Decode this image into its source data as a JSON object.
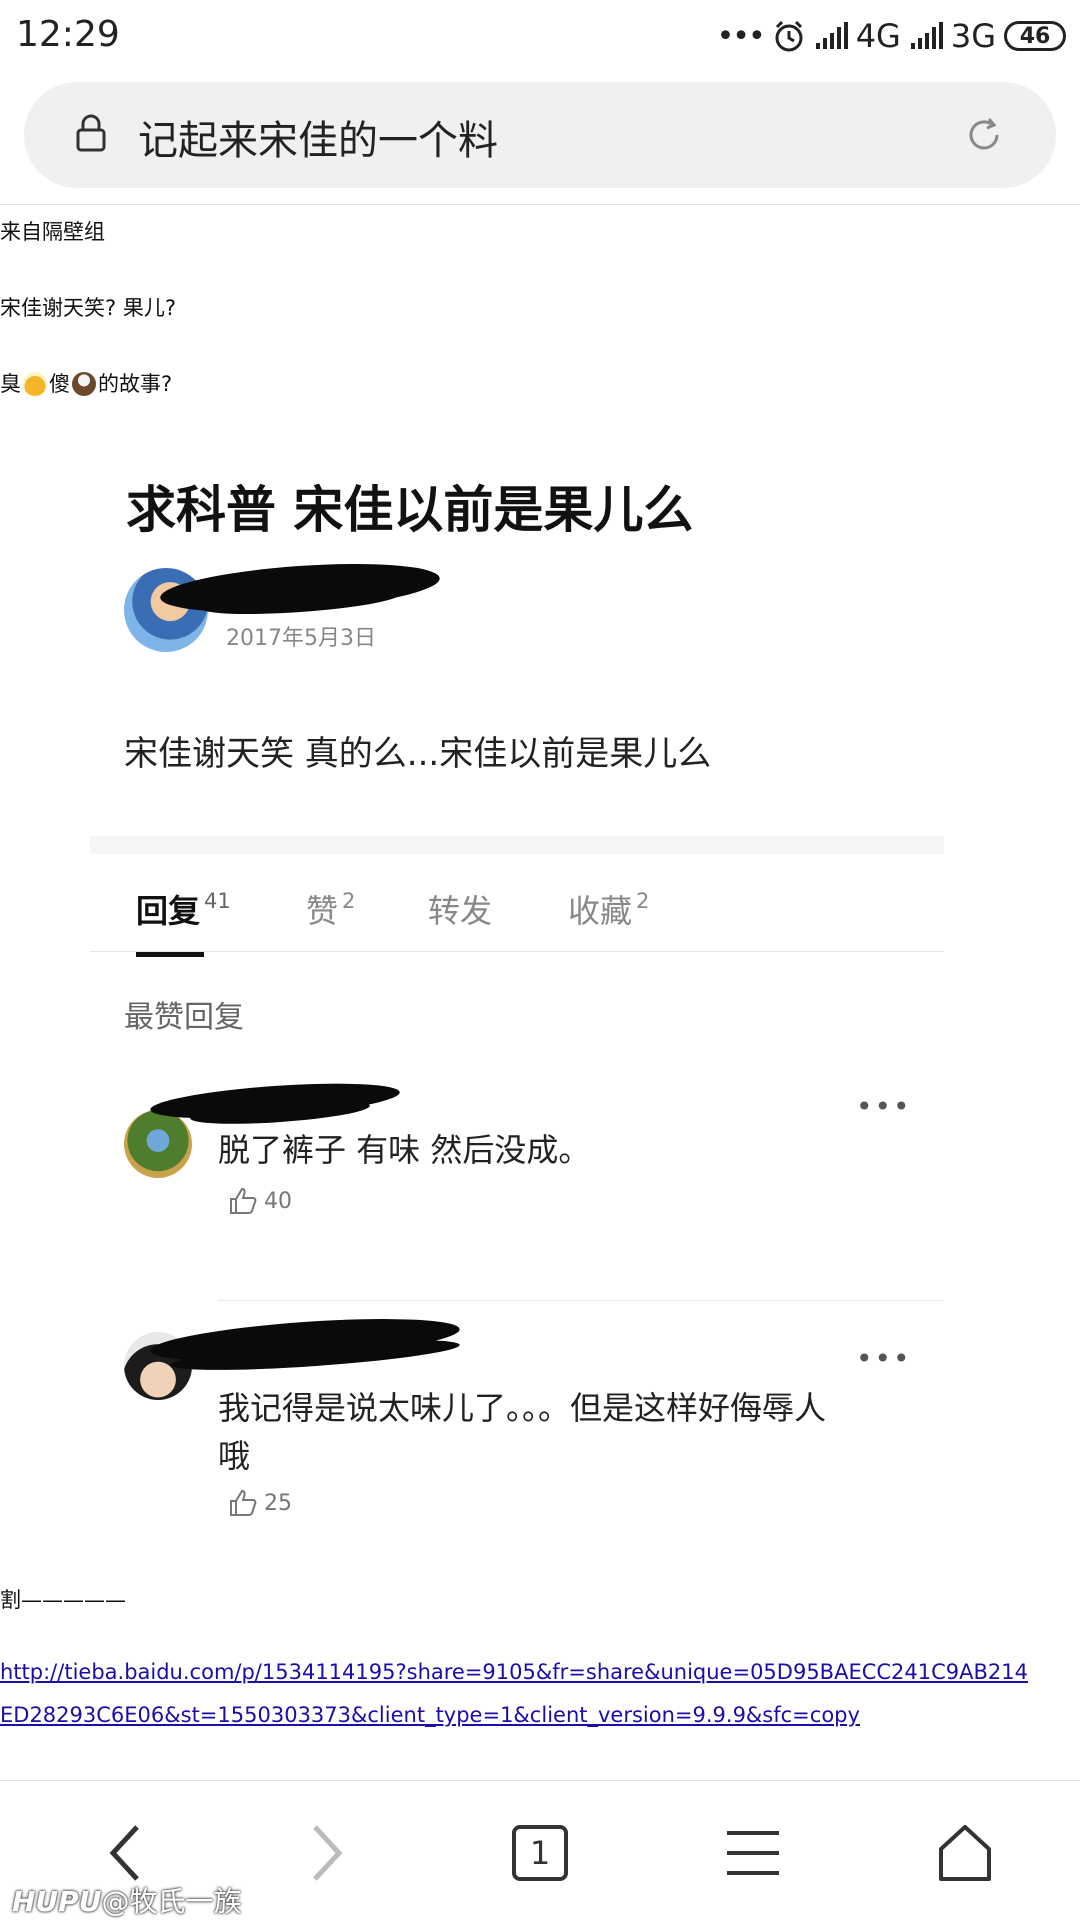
{
  "status_bar": {
    "time": "12:29",
    "network_1": "4G",
    "network_2": "3G",
    "battery": "46"
  },
  "address_bar": {
    "url_text": "记起来宋佳的一个料",
    "icons": [
      "lock-icon",
      "reload-icon"
    ]
  },
  "article": {
    "line1": "来自隔壁组",
    "line2": "宋佳谢天笑? 果儿?",
    "line3_a": "臭",
    "line3_b": "傻",
    "line3_c": "的故事?",
    "embed": {
      "title": "求科普  宋佳以前是果儿么",
      "date": "2017年5月3日",
      "body": "宋佳谢天笑  真的么...宋佳以前是果儿么",
      "tabs": [
        {
          "label": "回复",
          "count": "41"
        },
        {
          "label": "赞",
          "count": "2"
        },
        {
          "label": "转发",
          "count": ""
        },
        {
          "label": "收藏",
          "count": "2"
        }
      ],
      "section_label": "最赞回复",
      "replies": [
        {
          "text": "脱了裤子 有味 然后没成。",
          "likes": "40",
          "more": "•••"
        },
        {
          "text": "我记得是说太味儿了。。。但是这样好侮辱人哦",
          "likes": "25",
          "more": "•••"
        }
      ]
    },
    "cut_line": "割—————",
    "link_line1": "http://tieba.baidu.com/p/1534114195?share=9105&fr=share&unique=05D95BAECC241C9AB214",
    "link_line2": "ED28293C6E06&st=1550303373&client_type=1&client_version=9.9.9&sfc=copy"
  },
  "bottom_nav": {
    "tab_count": "1",
    "icons": [
      "back-icon",
      "forward-icon",
      "tabs-icon",
      "menu-icon",
      "home-icon"
    ]
  },
  "watermark": {
    "brand": "HUPU",
    "user": "@牧氏一族"
  }
}
